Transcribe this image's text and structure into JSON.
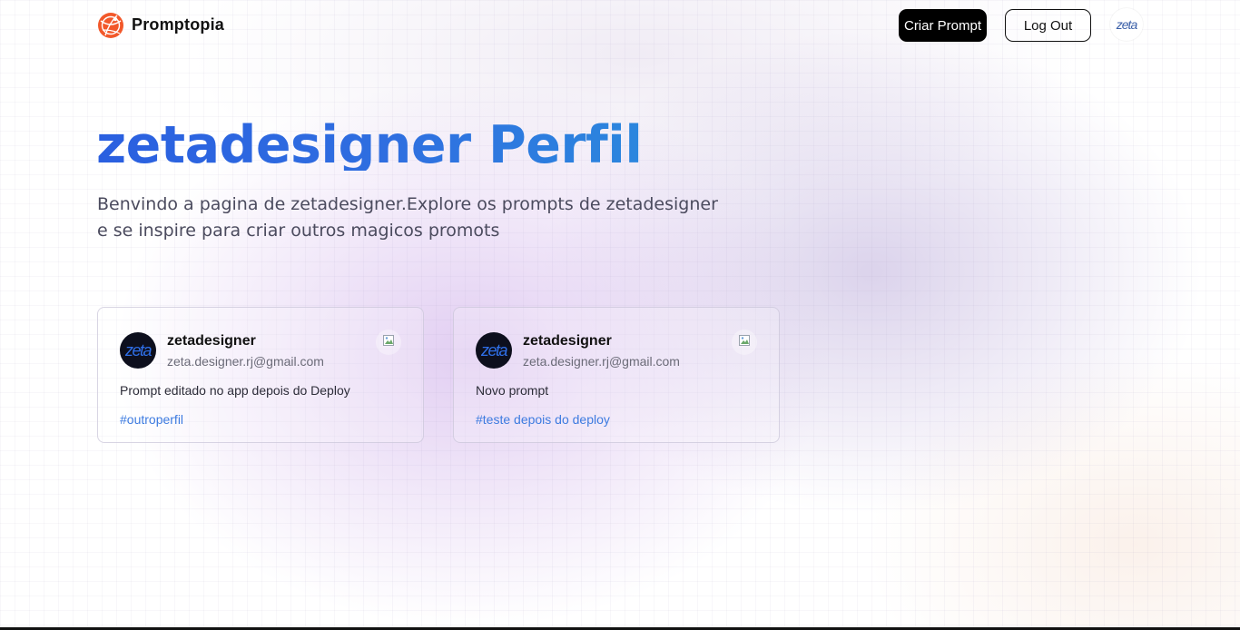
{
  "nav": {
    "brand": "Promptopia",
    "create_label": "Criar Prompt",
    "logout_label": "Log Out",
    "avatar_text": "zeta",
    "logo_color": "#F2582A"
  },
  "header": {
    "title": "zetadesigner Perfil",
    "description": "Benvindo a pagina de zetadesigner.Explore os prompts de zetadesigner e se inspire para criar outros magicos promots"
  },
  "cards": [
    {
      "avatar_text": "zeta",
      "username": "zetadesigner",
      "email": "zeta.designer.rj@gmail.com",
      "prompt": "Prompt editado no app depois do Deploy",
      "tag": "#outroperfil",
      "copy_icon": "copy-icon"
    },
    {
      "avatar_text": "zeta",
      "username": "zetadesigner",
      "email": "zeta.designer.rj@gmail.com",
      "prompt": "Novo prompt",
      "tag": "#teste depois do deploy",
      "copy_icon": "copy-icon"
    }
  ],
  "colors": {
    "title_gradient_start": "#2a5fe0",
    "title_gradient_end": "#2b86de",
    "tag": "#3d7be0",
    "button_dark": "#000000"
  }
}
